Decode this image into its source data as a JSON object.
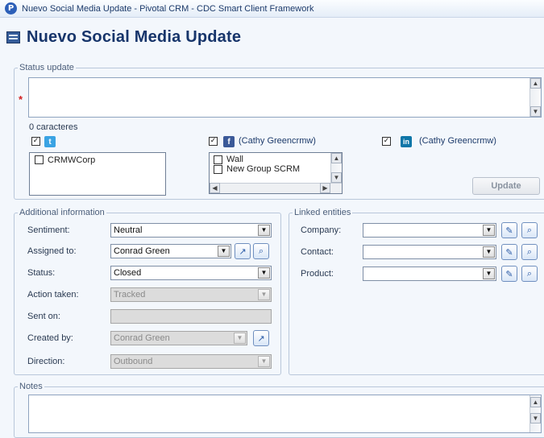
{
  "window": {
    "title": "Nuevo Social Media Update - Pivotal CRM - CDC Smart Client Framework",
    "app_icon": "P"
  },
  "page": {
    "title": "Nuevo Social Media Update"
  },
  "status_update": {
    "legend": "Status update",
    "required_marker": "*",
    "text_value": "",
    "char_count": "0 caracteres",
    "update_button": "Update",
    "twitter": {
      "checked": true,
      "accounts": [
        "CRMWCorp"
      ]
    },
    "facebook": {
      "checked": true,
      "account": "(Cathy Greencrmw)",
      "targets": [
        "Wall",
        "New Group SCRM"
      ]
    },
    "linkedin": {
      "checked": true,
      "account": "(Cathy Greencrmw)",
      "glyph": "in"
    }
  },
  "additional": {
    "legend": "Additional information",
    "sentiment": {
      "label": "Sentiment:",
      "value": "Neutral"
    },
    "assigned_to": {
      "label": "Assigned to:",
      "value": "Conrad Green"
    },
    "status": {
      "label": "Status:",
      "value": "Closed"
    },
    "action_taken": {
      "label": "Action taken:",
      "value": "Tracked"
    },
    "sent_on": {
      "label": "Sent on:",
      "value": ""
    },
    "created_by": {
      "label": "Created by:",
      "value": "Conrad Green"
    },
    "direction": {
      "label": "Direction:",
      "value": "Outbound"
    }
  },
  "linked": {
    "legend": "Linked entities",
    "company": {
      "label": "Company:",
      "value": ""
    },
    "contact": {
      "label": "Contact:",
      "value": ""
    },
    "product": {
      "label": "Product:",
      "value": ""
    }
  },
  "notes": {
    "legend": "Notes",
    "value": ""
  },
  "colors": {
    "twitter": "#3aa3e3",
    "facebook": "#3b5998",
    "linkedin": "#0e76a8",
    "required": "#d21f1f"
  }
}
